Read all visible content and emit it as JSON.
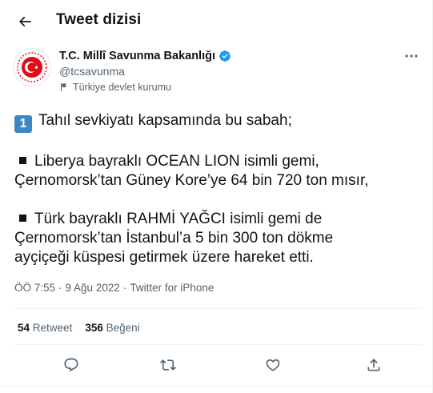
{
  "header": {
    "title": "Tweet dizisi"
  },
  "author": {
    "name": "T.C. Millî Savunma Bakanlığı",
    "handle": "@tcsavunma",
    "label": "Türkiye devlet kurumu"
  },
  "tweet": {
    "keycap": "1",
    "line1": "Tahıl sevkiyatı kapsamında bu sabah;",
    "para2_line1": "Liberya bayraklı OCEAN LION isimli gemi,",
    "para2_line2": "Çernomorsk’tan Güney Kore’ye 64 bin 720 ton mısır,",
    "para3_line1": "Türk bayraklı RAHMİ YAĞCI isimli gemi de",
    "para3_line2": "Çernomorsk’tan İstanbul’a 5 bin 300 ton dökme",
    "para3_line3": "ayçiçeği küspesi getirmek üzere hareket etti."
  },
  "meta": {
    "time": "ÖÖ 7:55",
    "sep1": "·",
    "date": "9 Ağu 2022",
    "sep2": "·",
    "source": "Twitter for iPhone"
  },
  "stats": {
    "retweets_count": "54",
    "retweets_label": "Retweet",
    "likes_count": "356",
    "likes_label": "Beğeni"
  },
  "colors": {
    "text": "#0f1419",
    "secondary": "#536471",
    "verified": "#1d9bf0",
    "keycap": "#3b88c3",
    "logo_red": "#e30a17"
  },
  "icons": [
    "back-arrow-icon",
    "verified-badge-icon",
    "flag-icon",
    "more-icon",
    "reply-icon",
    "retweet-icon",
    "like-icon",
    "share-icon"
  ]
}
